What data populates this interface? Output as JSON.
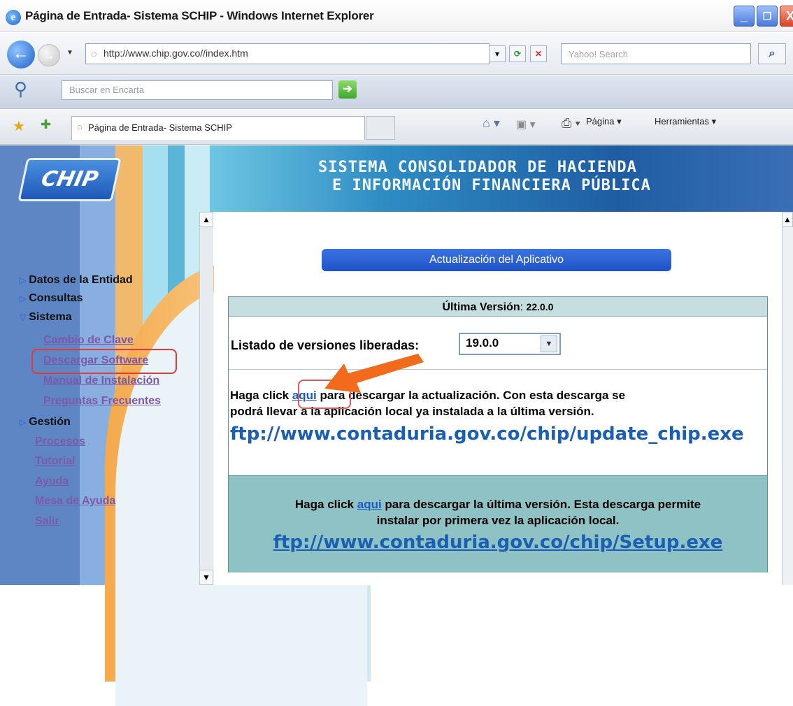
{
  "window": {
    "title": "Página de Entrada- Sistema SCHIP - Windows Internet Explorer",
    "minimize": "_",
    "maximize": "❐",
    "close": "X"
  },
  "address_bar": {
    "url": "http://www.chip.gov.co//index.htm",
    "search_placeholder": "Yahoo! Search"
  },
  "encarta": {
    "placeholder": "Buscar en Encarta"
  },
  "tabs": {
    "active_tab": "Página de Entrada- Sistema SCHIP",
    "pagina": "Página ▾",
    "herramientas": "Herramientas ▾"
  },
  "site": {
    "logo": "CHIP",
    "header_line1": "SISTEMA CONSOLIDADOR DE HACIENDA",
    "header_line2": "E INFORMACIÓN FINANCIERA PÚBLICA"
  },
  "sidebar": {
    "datos": "Datos de la Entidad",
    "consultas": "Consultas",
    "sistema": "Sistema",
    "cambio_clave": "Cambio de Clave",
    "descargar": "Descargar Software",
    "manual": "Manual de Instalación",
    "preguntas": "Preguntas Frecuentes",
    "gestion": "Gestión",
    "procesos": "Procesos",
    "tutorial": "Tutorial",
    "ayuda": "Ayuda",
    "mesa": "Mesa de Ayuda",
    "salir": "Salir"
  },
  "content": {
    "banner": "Actualización del Aplicativo",
    "ultima_label": "Última Versión",
    "ultima_value": "22.0.0",
    "versions_label": "Listado de versiones liberadas:",
    "versions_selected": "19.0.0",
    "update_pre": "Haga click ",
    "update_link_word": "aqui",
    "update_post": " para descargar la actualización. Con esta descarga se",
    "update_line2": "podrá llevar a la aplicación local ya instalada a la última versión.",
    "update_url": "ftp://www.contaduria.gov.co/chip/update_chip.exe",
    "setup_pre": "Haga click ",
    "setup_link_word": "aqui",
    "setup_post": " para descargar la última versión. Esta descarga permite",
    "setup_line2": "instalar por primera vez la aplicación local.",
    "setup_url": "ftp://www.contaduria.gov.co/chip/Setup.exe"
  },
  "colors": {
    "arrow": "#f26a1b",
    "banner": "#2559d0",
    "highlight": "#e03a3a"
  }
}
